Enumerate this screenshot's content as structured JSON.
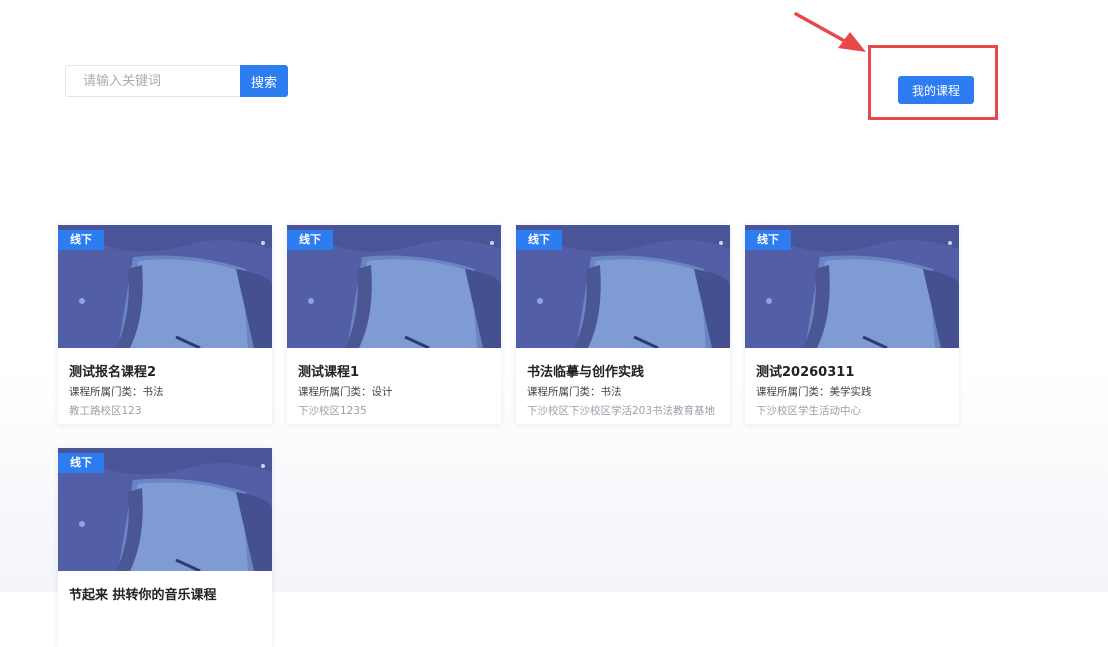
{
  "search": {
    "placeholder": "请输入关键词",
    "button_label": "搜索"
  },
  "header": {
    "my_courses_label": "我的课程"
  },
  "colors": {
    "accent": "#2d7cf0",
    "highlight": "#e8484a"
  },
  "courses": [
    {
      "tag": "线下",
      "title": "测试报名课程2",
      "category": "课程所属门类：书法",
      "location": "教工路校区123"
    },
    {
      "tag": "线下",
      "title": "测试课程1",
      "category": "课程所属门类：设计",
      "location": "下沙校区1235"
    },
    {
      "tag": "线下",
      "title": "书法临摹与创作实践",
      "category": "课程所属门类：书法",
      "location": "下沙校区下沙校区学活203书法教育基地"
    },
    {
      "tag": "线下",
      "title": "测试20260311",
      "category": "课程所属门类：美学实践",
      "location": "下沙校区学生活动中心"
    },
    {
      "tag": "线下",
      "title": "节起来 拱转你的音乐课程",
      "category": "",
      "location": ""
    }
  ]
}
